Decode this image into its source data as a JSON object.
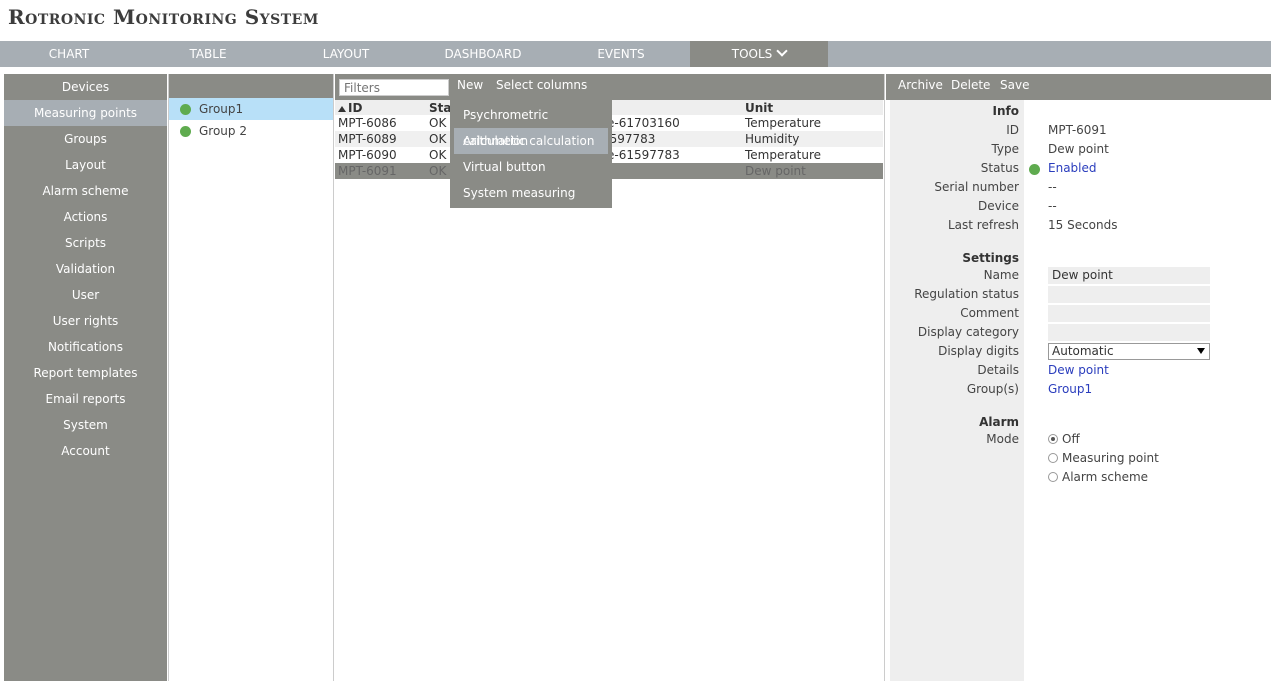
{
  "app": {
    "title": "Rotronic Monitoring System"
  },
  "topnav": {
    "tabs": [
      {
        "label": "CHART"
      },
      {
        "label": "TABLE"
      },
      {
        "label": "LAYOUT"
      },
      {
        "label": "DASHBOARD"
      },
      {
        "label": "EVENTS"
      },
      {
        "label": "TOOLS"
      }
    ],
    "active": "TOOLS"
  },
  "sidebar": {
    "items": [
      {
        "label": "Devices"
      },
      {
        "label": "Measuring points"
      },
      {
        "label": "Groups"
      },
      {
        "label": "Layout"
      },
      {
        "label": "Alarm scheme"
      },
      {
        "label": "Actions"
      },
      {
        "label": "Scripts"
      },
      {
        "label": "Validation"
      },
      {
        "label": "User"
      },
      {
        "label": "User rights"
      },
      {
        "label": "Notifications"
      },
      {
        "label": "Report templates"
      },
      {
        "label": "Email reports"
      },
      {
        "label": "System"
      },
      {
        "label": "Account"
      }
    ],
    "active": "Measuring points"
  },
  "groups": {
    "items": [
      {
        "label": "Group1"
      },
      {
        "label": "Group 2"
      }
    ]
  },
  "toolbar": {
    "filter_placeholder": "Filters",
    "new_label": "New",
    "select_columns_label": "Select columns"
  },
  "table": {
    "headers": {
      "id": "ID",
      "status": "Stat",
      "name": "",
      "unit": "Unit"
    },
    "rows": [
      {
        "id": "MPT-6086",
        "status": "OK",
        "name": "ture-61703160",
        "unit": "Temperature"
      },
      {
        "id": "MPT-6089",
        "status": "OK",
        "name": "-61597783",
        "unit": "Humidity"
      },
      {
        "id": "MPT-6090",
        "status": "OK",
        "name": "ture-61597783",
        "unit": "Temperature"
      },
      {
        "id": "MPT-6091",
        "status": "OK",
        "name": "nt",
        "unit": "Dew point"
      }
    ]
  },
  "new_menu": {
    "items": [
      {
        "label": "Psychrometric calculation"
      },
      {
        "label": "Arithmetic calculation"
      },
      {
        "label": "Virtual button"
      },
      {
        "label": "System measuring point"
      }
    ]
  },
  "detail": {
    "toolbar": {
      "archive": "Archive",
      "delete": "Delete",
      "save": "Save"
    },
    "info": {
      "heading": "Info",
      "id_label": "ID",
      "id_value": "MPT-6091",
      "type_label": "Type",
      "type_value": "Dew point",
      "status_label": "Status",
      "status_value": "Enabled",
      "serial_label": "Serial number",
      "serial_value": "--",
      "device_label": "Device",
      "device_value": "--",
      "refresh_label": "Last refresh",
      "refresh_value": "15 Seconds"
    },
    "settings": {
      "heading": "Settings",
      "name_label": "Name",
      "name_value": "Dew point",
      "regulation_label": "Regulation status",
      "regulation_value": "",
      "comment_label": "Comment",
      "comment_value": "",
      "category_label": "Display category",
      "category_value": "",
      "digits_label": "Display digits",
      "digits_value": "Automatic",
      "details_label": "Details",
      "details_value": "Dew point",
      "groups_label": "Group(s)",
      "groups_value": "Group1"
    },
    "alarm": {
      "heading": "Alarm",
      "mode_label": "Mode",
      "options": [
        {
          "label": "Off"
        },
        {
          "label": "Measuring point"
        },
        {
          "label": "Alarm scheme"
        }
      ],
      "selected": "Off"
    }
  },
  "colors": {
    "panel": "#8a8b86",
    "nav": "#a7aeb4",
    "ok_dot": "#5fab4f",
    "link": "#2a3dbd",
    "selected_group": "#b8e0f8"
  }
}
